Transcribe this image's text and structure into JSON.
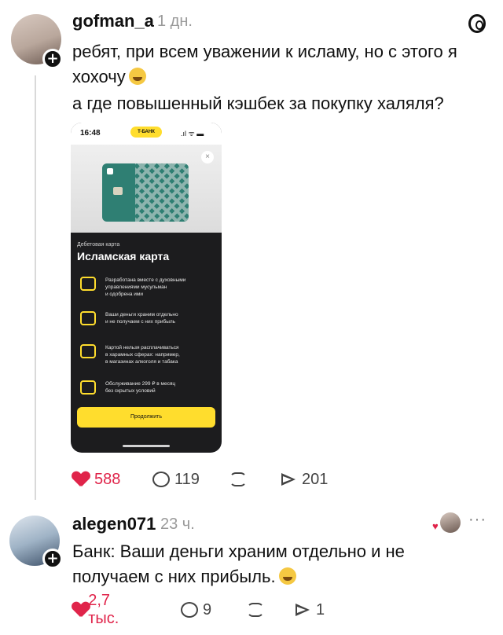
{
  "post": {
    "username": "gofman_a",
    "time": "1 дн.",
    "lines": [
      "ребят, при всем уважении к исламу, но с этого я",
      "хохочу",
      "а где повышенный кэшбек за покупку халяля?"
    ],
    "stats": {
      "likes": "588",
      "comments": "119",
      "reposts": "",
      "shares": "201"
    }
  },
  "screenshot": {
    "status_time": "16:48",
    "bank_label": "T-БАНК",
    "status_icons": ".ıl ᯤ ▬",
    "close_symbol": "×",
    "card_type": "Дебетовая карта",
    "card_title": "Исламская карта",
    "features": [
      {
        "icon": "handshake-icon",
        "text": "Разработана вместе с духовными\nуправлениями мусульман\nи одобрена ими"
      },
      {
        "icon": "shield-icon",
        "text": "Ваши деньги храним отдельно\nи не получаем с них прибыль"
      },
      {
        "icon": "cross-icon",
        "text": "Картой нельзя расплачиваться\nв харамных сферах: например,\nв магазинах алкоголя и табака"
      },
      {
        "icon": "heart-hand-icon",
        "text": "Обслуживание 299 ₽ в месяц\nбез скрытых условий"
      }
    ],
    "button_label": "Продолжить"
  },
  "reply": {
    "username": "alegen071",
    "time": "23 ч.",
    "lines": [
      "Банк: Ваши деньги храним отдельно и не",
      "получаем с них прибыль."
    ],
    "stats": {
      "likes": "2,7 тыс.",
      "comments": "9",
      "reposts": "",
      "shares": "1"
    },
    "more_label": "···"
  },
  "colors": {
    "accent": "#e0244a",
    "bank_yellow": "#ffdd2d",
    "card_teal": "#2f7f73"
  }
}
